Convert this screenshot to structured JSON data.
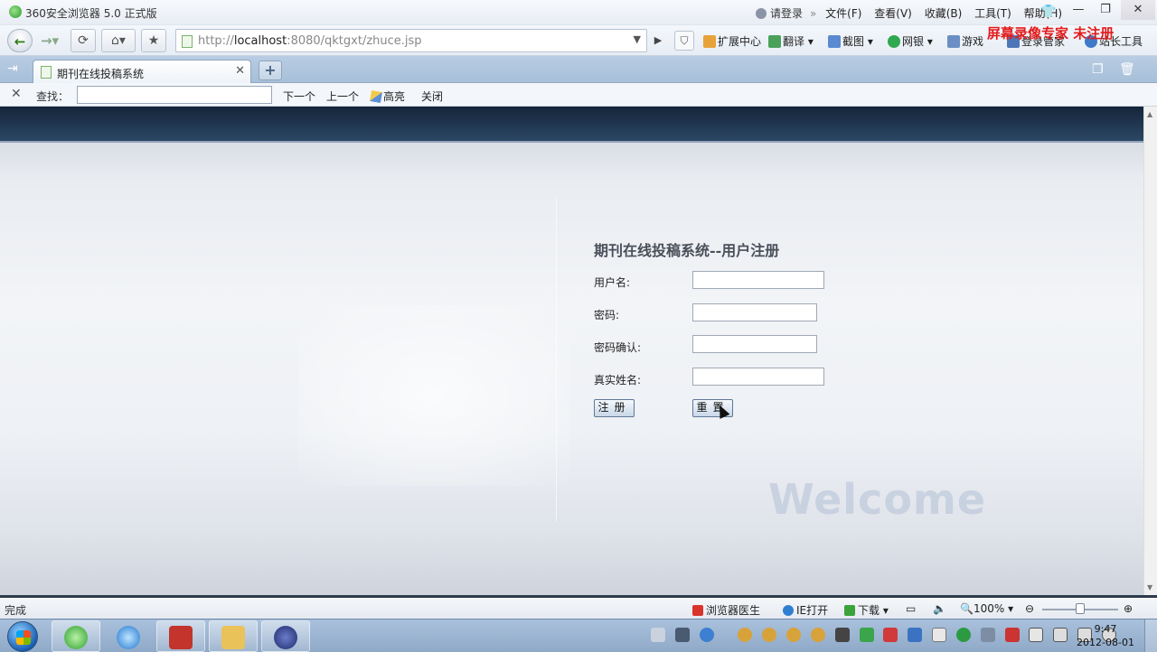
{
  "window": {
    "title": "360安全浏览器 5.0 正式版",
    "login": "请登录",
    "menus": [
      "文件(F)",
      "查看(V)",
      "收藏(B)",
      "工具(T)",
      "帮助(H)"
    ],
    "minimize": "—",
    "restore": "❐",
    "close": "✕"
  },
  "toolbar": {
    "url_prefix": "http://",
    "url_host": "localhost",
    "url_rest": ":8080/qktgxt/zhuce.jsp",
    "extensions": "扩展中心",
    "translate": "翻译",
    "screenshot": "截图",
    "netbank": "网银",
    "games": "游戏",
    "login_manager": "登录管家",
    "webmaster": "站长工具"
  },
  "watermark": "屏幕录像专家 未注册",
  "tabs": [
    {
      "label": "期刊在线投稿系统"
    }
  ],
  "findbar": {
    "label": "查找：",
    "value": "",
    "next": "下一个",
    "prev": "上一个",
    "highlight": "高亮",
    "close": "关闭"
  },
  "page": {
    "title": "期刊在线投稿系统--用户注册",
    "fields": [
      {
        "label": "用户名:",
        "value": ""
      },
      {
        "label": "密码:",
        "value": ""
      },
      {
        "label": "密码确认:",
        "value": ""
      },
      {
        "label": "真实姓名:",
        "value": ""
      }
    ],
    "register_button": "注册",
    "reset_button": "重置",
    "welcome": "Welcome"
  },
  "statusbar": {
    "status": "完成",
    "doctor": "浏览器医生",
    "ie_open": "IE打开",
    "download": "下载",
    "zoom": "100%"
  },
  "taskbar": {
    "time": "9:47",
    "date": "2012-08-01"
  }
}
